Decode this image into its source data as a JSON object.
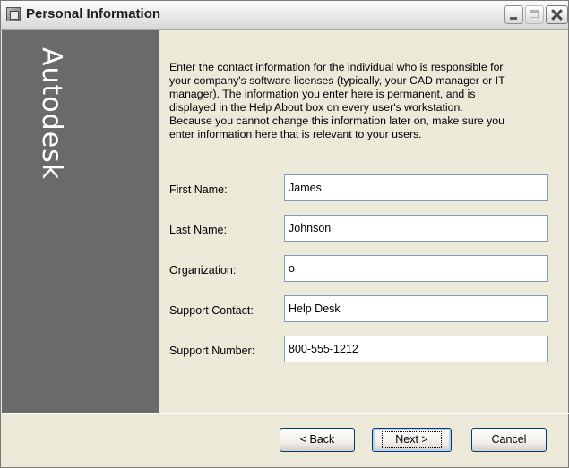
{
  "window": {
    "title": "Personal Information",
    "icon": "app-icon",
    "controls": [
      "minimize-icon",
      "maximize-icon",
      "close-icon"
    ]
  },
  "brand": {
    "name": "Autodesk",
    "panel_color": "#6a6a6a"
  },
  "intro_text": "Enter the contact information for the individual who is responsible for\nyour company's software licenses (typically, your CAD manager or IT\nmanager).  The information you enter here is permanent, and is\ndisplayed in the Help About box on every user's workstation.\nBecause you cannot change this information later on, make sure you\nenter information here that is relevant to your users.",
  "form": {
    "first_name": {
      "label": "First Name:",
      "value": "James"
    },
    "last_name": {
      "label": "Last Name:",
      "value": "Johnson"
    },
    "organization": {
      "label": "Organization:",
      "value": "o"
    },
    "support_contact": {
      "label": "Support Contact:",
      "value": "Help Desk"
    },
    "support_number": {
      "label": "Support Number:",
      "value": "800-555-1212"
    }
  },
  "buttons": {
    "back": "< Back",
    "next": "Next >",
    "cancel": "Cancel"
  }
}
